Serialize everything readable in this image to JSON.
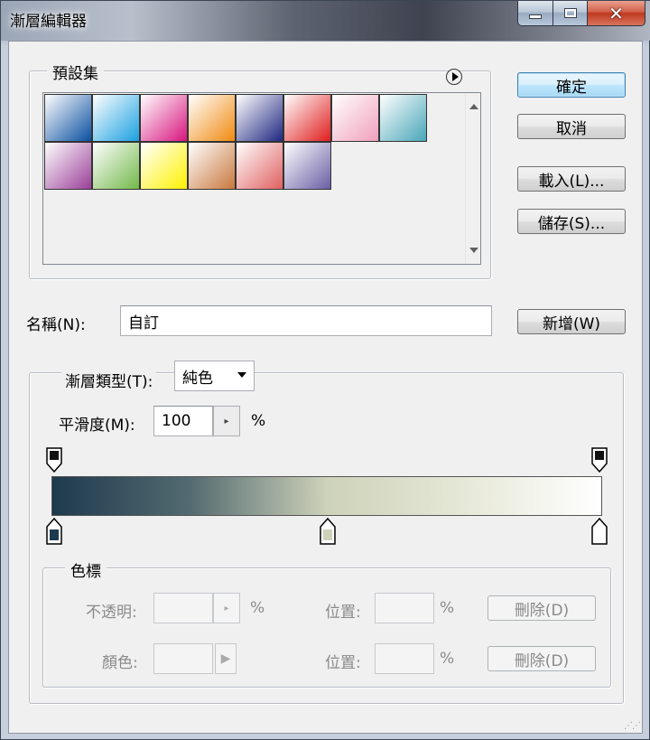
{
  "window": {
    "title": "漸層編輯器",
    "minimize_icon": "minimize-icon",
    "maximize_icon": "maximize-icon",
    "close_glyph": "✕"
  },
  "presets": {
    "legend": "預設集",
    "swatches": [
      {
        "from": "#ffffff",
        "to": "#0a4fa0"
      },
      {
        "from": "#ffffff",
        "to": "#1aa0e0"
      },
      {
        "from": "#ffffff",
        "to": "#d8157e"
      },
      {
        "from": "#ffffff",
        "to": "#f08a10"
      },
      {
        "from": "#ffffff",
        "to": "#202780"
      },
      {
        "from": "#ffffff",
        "to": "#e01d1d"
      },
      {
        "from": "#ffffff",
        "to": "#f0a0bc"
      },
      {
        "from": "#ffffff",
        "to": "#49a6b8"
      },
      {
        "from": "#ffffff",
        "to": "#9a3f98"
      },
      {
        "from": "#ffffff",
        "to": "#73b84a"
      },
      {
        "from": "#ffffff",
        "to": "#fff200"
      },
      {
        "from": "#ffffff",
        "to": "#c9783e"
      },
      {
        "from": "#ffffff",
        "to": "#e06060"
      },
      {
        "from": "#ffffff",
        "to": "#6a5ea4"
      }
    ]
  },
  "buttons": {
    "ok": "確定",
    "cancel": "取消",
    "load": "載入(L)...",
    "save": "儲存(S)...",
    "new": "新增(W)"
  },
  "name": {
    "label": "名稱(N):",
    "value": "自訂"
  },
  "gradient": {
    "type_label": "漸層類型(T):",
    "type_value": "純色",
    "smoothness_label": "平滑度(M):",
    "smoothness_value": "100",
    "smoothness_unit": "%",
    "color_stops": [
      {
        "position": 0.0,
        "color": "#1e3a4e"
      },
      {
        "position": 0.5,
        "color": "#cdd2b9"
      },
      {
        "position": 1.0,
        "color": "#ffffff"
      }
    ],
    "opacity_stops": [
      {
        "position": 0.0
      },
      {
        "position": 1.0
      }
    ]
  },
  "stops_panel": {
    "legend": "色標",
    "opacity_label": "不透明:",
    "opacity_unit": "%",
    "location_label": "位置:",
    "location_unit": "%",
    "delete_label": "刪除(D)",
    "color_label": "顏色:"
  },
  "colors": {
    "default_button_border": "#3c7fb1",
    "close_button": "#c0391f"
  }
}
